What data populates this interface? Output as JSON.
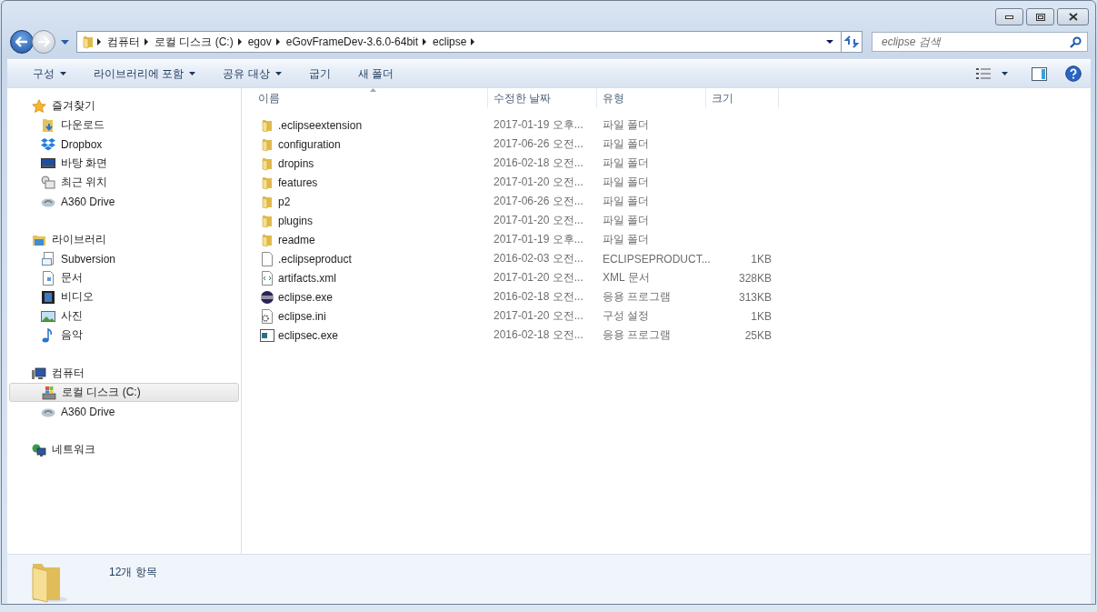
{
  "address_bar": {
    "segments": [
      "컴퓨터",
      "로컬 디스크 (C:)",
      "egov",
      "eGovFrameDev-3.6.0-64bit",
      "eclipse"
    ]
  },
  "search": {
    "placeholder": "eclipse 검색"
  },
  "toolbar": {
    "items": [
      {
        "label": "구성",
        "dropdown": true
      },
      {
        "label": "라이브러리에 포함",
        "dropdown": true
      },
      {
        "label": "공유 대상",
        "dropdown": true
      },
      {
        "label": "굽기",
        "dropdown": false
      },
      {
        "label": "새 폴더",
        "dropdown": false
      }
    ]
  },
  "sidebar": {
    "groups": [
      {
        "label": "즐겨찾기",
        "items": [
          {
            "label": "다운로드",
            "selected": false
          },
          {
            "label": "Dropbox",
            "selected": false
          },
          {
            "label": "바탕 화면",
            "selected": false
          },
          {
            "label": "최근 위치",
            "selected": false
          },
          {
            "label": "A360 Drive",
            "selected": false
          }
        ]
      },
      {
        "label": "라이브러리",
        "items": [
          {
            "label": "Subversion",
            "selected": false
          },
          {
            "label": "문서",
            "selected": false
          },
          {
            "label": "비디오",
            "selected": false
          },
          {
            "label": "사진",
            "selected": false
          },
          {
            "label": "음악",
            "selected": false
          }
        ]
      },
      {
        "label": "컴퓨터",
        "items": [
          {
            "label": "로컬 디스크 (C:)",
            "selected": true
          },
          {
            "label": "A360 Drive",
            "selected": false
          }
        ]
      },
      {
        "label": "네트워크"
      }
    ]
  },
  "table": {
    "columns": [
      {
        "label": "이름",
        "sorted": true
      },
      {
        "label": "수정한 날짜",
        "sorted": false
      },
      {
        "label": "유형",
        "sorted": false
      },
      {
        "label": "크기",
        "sorted": false
      }
    ],
    "rows": [
      {
        "kind": "folder",
        "name": ".eclipseextension",
        "date": "2017-01-19 오후...",
        "type": "파일 폴더"
      },
      {
        "kind": "folder",
        "name": "configuration",
        "date": "2017-06-26 오전...",
        "type": "파일 폴더"
      },
      {
        "kind": "folder",
        "name": "dropins",
        "date": "2016-02-18 오전...",
        "type": "파일 폴더"
      },
      {
        "kind": "folder",
        "name": "features",
        "date": "2017-01-20 오전...",
        "type": "파일 폴더"
      },
      {
        "kind": "folder",
        "name": "p2",
        "date": "2017-06-26 오전...",
        "type": "파일 폴더"
      },
      {
        "kind": "folder",
        "name": "plugins",
        "date": "2017-01-20 오전...",
        "type": "파일 폴더"
      },
      {
        "kind": "folder",
        "name": "readme",
        "date": "2017-01-19 오후...",
        "type": "파일 폴더"
      },
      {
        "kind": "document",
        "name": ".eclipseproduct",
        "date": "2016-02-03 오전...",
        "type": "ECLIPSEPRODUCT...",
        "size": "1KB"
      },
      {
        "kind": "xml",
        "name": "artifacts.xml",
        "date": "2017-01-20 오전...",
        "type": "XML 문서",
        "size": "328KB"
      },
      {
        "kind": "application",
        "name": "eclipse.exe",
        "date": "2016-02-18 오전...",
        "type": "응용 프로그램",
        "size": "313KB"
      },
      {
        "kind": "settings",
        "name": "eclipse.ini",
        "date": "2017-01-20 오전...",
        "type": "구성 설정",
        "size": "1KB"
      },
      {
        "kind": "console",
        "name": "eclipsec.exe",
        "date": "2016-02-18 오전...",
        "type": "응용 프로그램",
        "size": "25KB"
      }
    ]
  },
  "status_bar": {
    "text": "12개 항목"
  }
}
